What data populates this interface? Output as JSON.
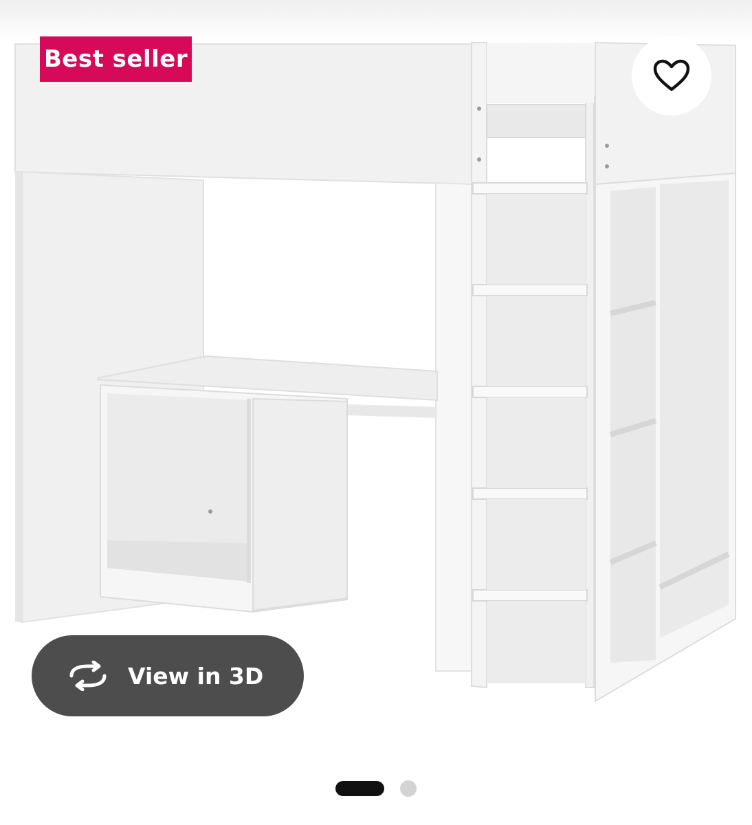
{
  "product": {
    "badge": "Best seller",
    "view_3d_label": "View in 3D"
  },
  "icons": {
    "favorite": "heart-icon",
    "view_3d": "rotate-3d-icon"
  },
  "carousel": {
    "total": 2,
    "active": 1
  },
  "colors": {
    "badge": "#d70a5a",
    "view_3d_button": "#4d4d4d",
    "dot_active": "#111111",
    "dot_inactive": "#d3d3d3"
  }
}
